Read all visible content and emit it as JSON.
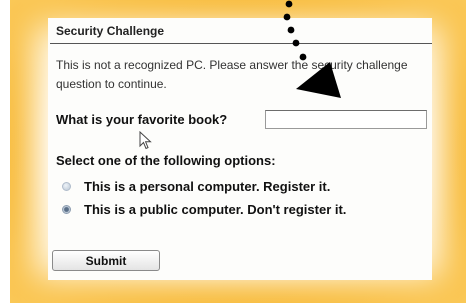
{
  "challenge": {
    "title": "Security Challenge",
    "intro": "This is not a recognized PC. Please answer the security challenge question to continue.",
    "question_label": "What is your favorite book?",
    "answer_value": "",
    "options_heading": "Select one of the following options:",
    "options": [
      {
        "label": "This is a personal computer. Register it.",
        "selected": false
      },
      {
        "label": "This is a public computer. Don't register it.",
        "selected": true
      }
    ],
    "submit_label": "Submit"
  },
  "highlight": {
    "glow_color": "#f7b52a",
    "pointer_color": "#000000"
  }
}
